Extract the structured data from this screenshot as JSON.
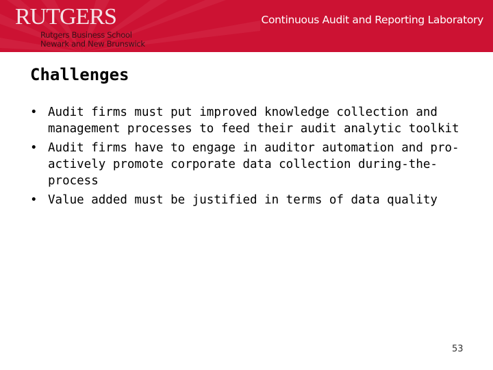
{
  "header": {
    "logo_text": "RUTGERS",
    "school_line1": "Rutgers Business School",
    "school_line2": "Newark and New Brunswick",
    "lab_title": "Continuous Audit and Reporting Laboratory",
    "background_color": "#cc1233"
  },
  "slide": {
    "title": "Challenges",
    "bullets": [
      {
        "text": "Audit firms must put improved knowledge collection and management processes to feed their audit analytic toolkit"
      },
      {
        "text": "Audit firms have to engage in auditor automation and pro-actively promote corporate data collection during-the-process"
      },
      {
        "text": "Value added must be justified in terms of data quality"
      }
    ],
    "page_number": "53"
  }
}
